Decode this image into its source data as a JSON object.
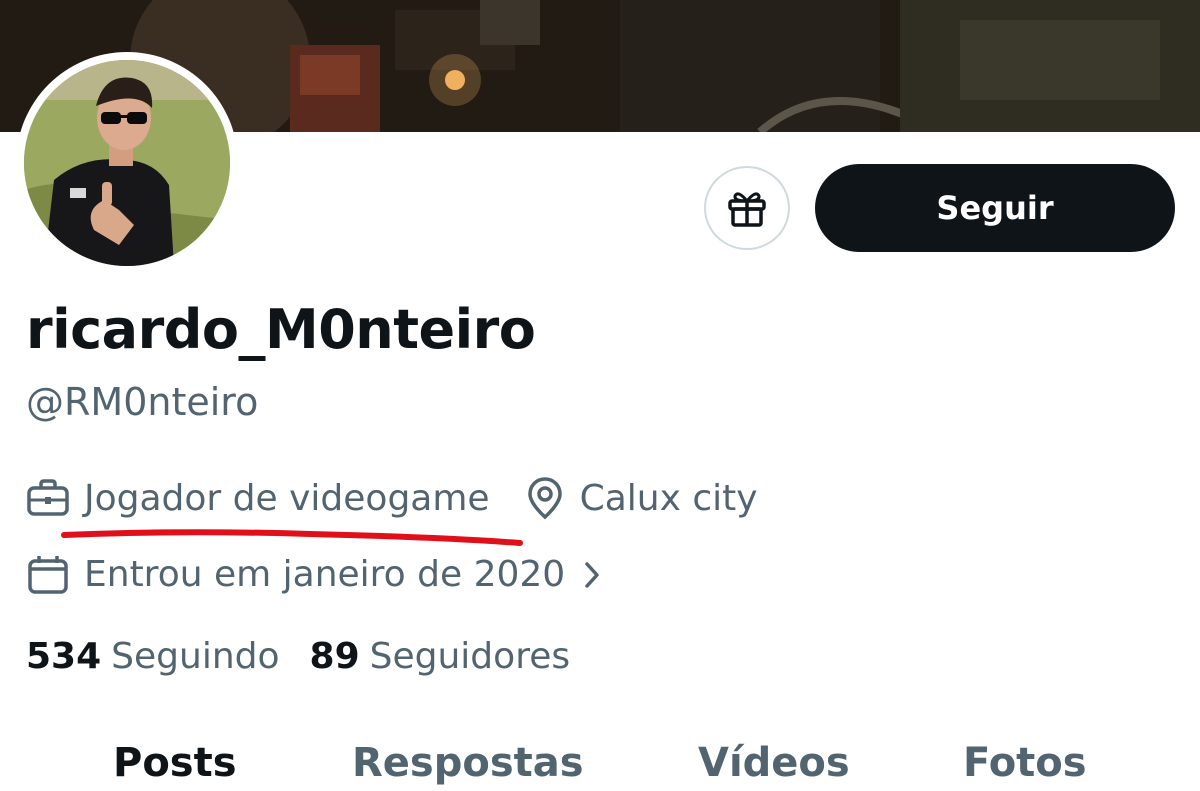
{
  "profile": {
    "display_name": "ricardo_M0nteiro",
    "handle": "@RM0nteiro",
    "profession": "Jogador de videogame",
    "location": "Calux city",
    "joined": "Entrou em janeiro de 2020"
  },
  "actions": {
    "follow_label": "Seguir",
    "gift_icon": "gift-icon"
  },
  "stats": {
    "following_count": "534",
    "following_label": "Seguindo",
    "followers_count": "89",
    "followers_label": "Seguidores"
  },
  "tabs": [
    {
      "label": "Posts",
      "active": true
    },
    {
      "label": "Respostas",
      "active": false
    },
    {
      "label": "Vídeos",
      "active": false
    },
    {
      "label": "Fotos",
      "active": false
    }
  ],
  "icons": {
    "profession": "briefcase-icon",
    "location": "map-pin-icon",
    "joined": "calendar-icon",
    "joined_chevron": "chevron-right-icon"
  },
  "colors": {
    "text_primary": "#0f1419",
    "text_secondary": "#536471",
    "follow_button": "#0f1419",
    "annotation_underline": "#e0101a"
  }
}
